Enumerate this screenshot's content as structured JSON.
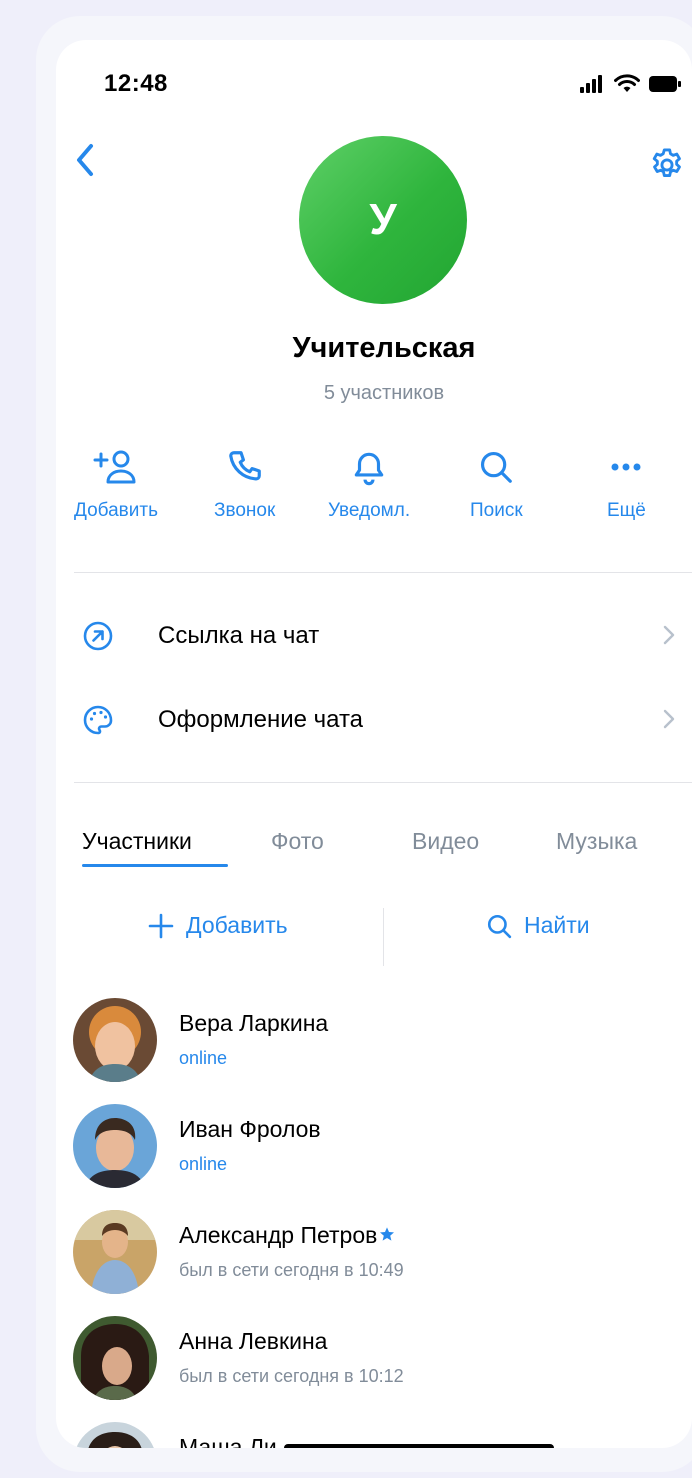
{
  "status_bar": {
    "time": "12:48"
  },
  "chat": {
    "avatar_letter": "У",
    "title": "Учительская",
    "subtitle": "5 участников"
  },
  "actions": [
    {
      "label": "Добавить",
      "icon": "add-user-icon"
    },
    {
      "label": "Звонок",
      "icon": "phone-icon"
    },
    {
      "label": "Уведомл.",
      "icon": "bell-icon"
    },
    {
      "label": "Поиск",
      "icon": "search-icon"
    },
    {
      "label": "Ещё",
      "icon": "more-icon"
    }
  ],
  "settings_rows": [
    {
      "label": "Ссылка на чат",
      "icon": "link-arrow-icon"
    },
    {
      "label": "Оформление чата",
      "icon": "palette-icon"
    }
  ],
  "tabs": [
    {
      "label": "Участники",
      "active": true
    },
    {
      "label": "Фото",
      "active": false
    },
    {
      "label": "Видео",
      "active": false
    },
    {
      "label": "Музыка",
      "active": false
    }
  ],
  "member_actions": {
    "add_label": "Добавить",
    "find_label": "Найти"
  },
  "members": [
    {
      "name": "Вера Ларкина",
      "status": "online",
      "online": true
    },
    {
      "name": "Иван Фролов",
      "status": "online",
      "online": true
    },
    {
      "name": "Александр Петров",
      "status": "был в сети сегодня в 10:49",
      "online": false,
      "starred": true
    },
    {
      "name": "Анна Левкина",
      "status": "был в сети сегодня в 10:12",
      "online": false
    },
    {
      "name": "Маша Ли",
      "status": "",
      "online": false
    }
  ],
  "colors": {
    "accent": "#2688eb",
    "secondary_text": "#818c99",
    "avatar_green": "#2fb53d"
  }
}
